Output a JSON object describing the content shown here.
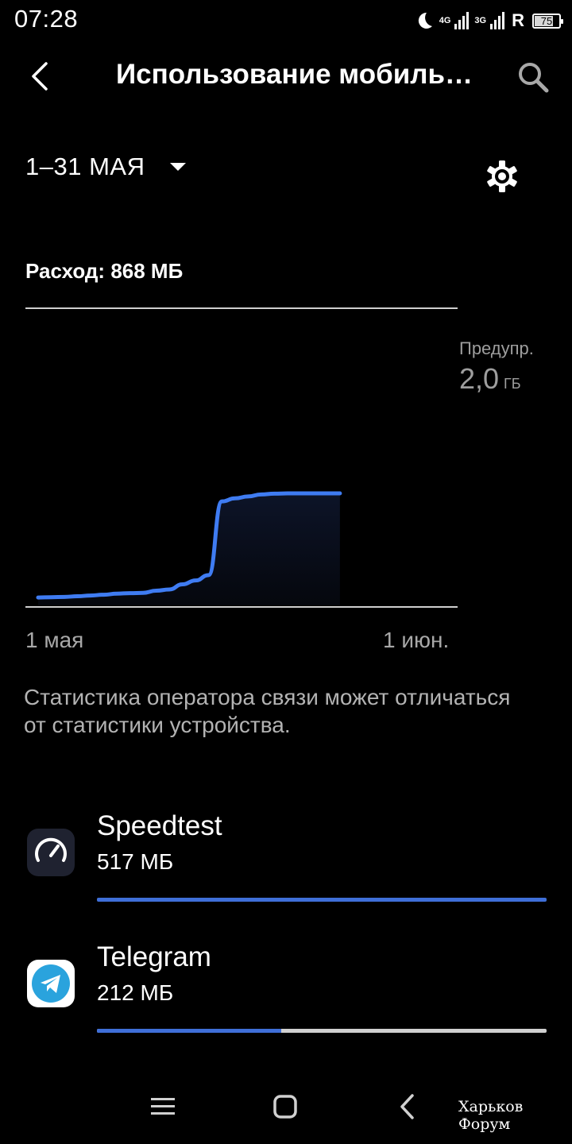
{
  "status_bar": {
    "time": "07:28",
    "network_1": "4G",
    "network_2": "3G",
    "roaming": "R",
    "battery": "75",
    "battery_level": 0.75,
    "icons": [
      "moon-icon",
      "signal-icon",
      "signal-icon",
      "battery-icon"
    ]
  },
  "header": {
    "title": "Использование мобиль…",
    "back_icon": "back-arrow-icon",
    "search_icon": "search-icon"
  },
  "period": {
    "label": "1–31 МАЯ",
    "dropdown_icon": "caret-down-icon",
    "settings_icon": "gear-icon"
  },
  "usage": {
    "label": "Расход:",
    "value": "868 МБ"
  },
  "chart_data": {
    "type": "area",
    "x_start_label": "1 мая",
    "x_end_label": "1 июн.",
    "warning_label": "Предупр.",
    "warning_value": "2,0",
    "warning_unit": "ГБ",
    "x_days": [
      1,
      2,
      3,
      4,
      5,
      6,
      7,
      8,
      9,
      10,
      11,
      12,
      13,
      14,
      15,
      16,
      17,
      18,
      19,
      20,
      21,
      22,
      23,
      24
    ],
    "y_mb": [
      20,
      22,
      24,
      28,
      33,
      38,
      45,
      48,
      50,
      64,
      72,
      105,
      130,
      165,
      640,
      660,
      672,
      685,
      690,
      692,
      692,
      692,
      692,
      692
    ],
    "xlim_days": [
      1,
      32
    ],
    "ylim_mb": [
      0,
      2000
    ],
    "line_color": "#3f7cf2"
  },
  "note": "Статистика оператора связи может отличаться от статистики устройства.",
  "apps": [
    {
      "name": "Speedtest",
      "usage": "517 МБ",
      "fraction": 1.0,
      "icon": "speedometer-icon"
    },
    {
      "name": "Telegram",
      "usage": "212 МБ",
      "fraction": 0.41,
      "icon": "telegram-icon"
    }
  ],
  "navbar": {
    "menu_icon": "menu-icon",
    "home_icon": "home-icon",
    "back_icon": "back-icon"
  },
  "watermark": "Харьков Форум",
  "colors": {
    "background": "#000000",
    "accent": "#3f6fd8",
    "secondary_text": "#9e9e9e"
  }
}
